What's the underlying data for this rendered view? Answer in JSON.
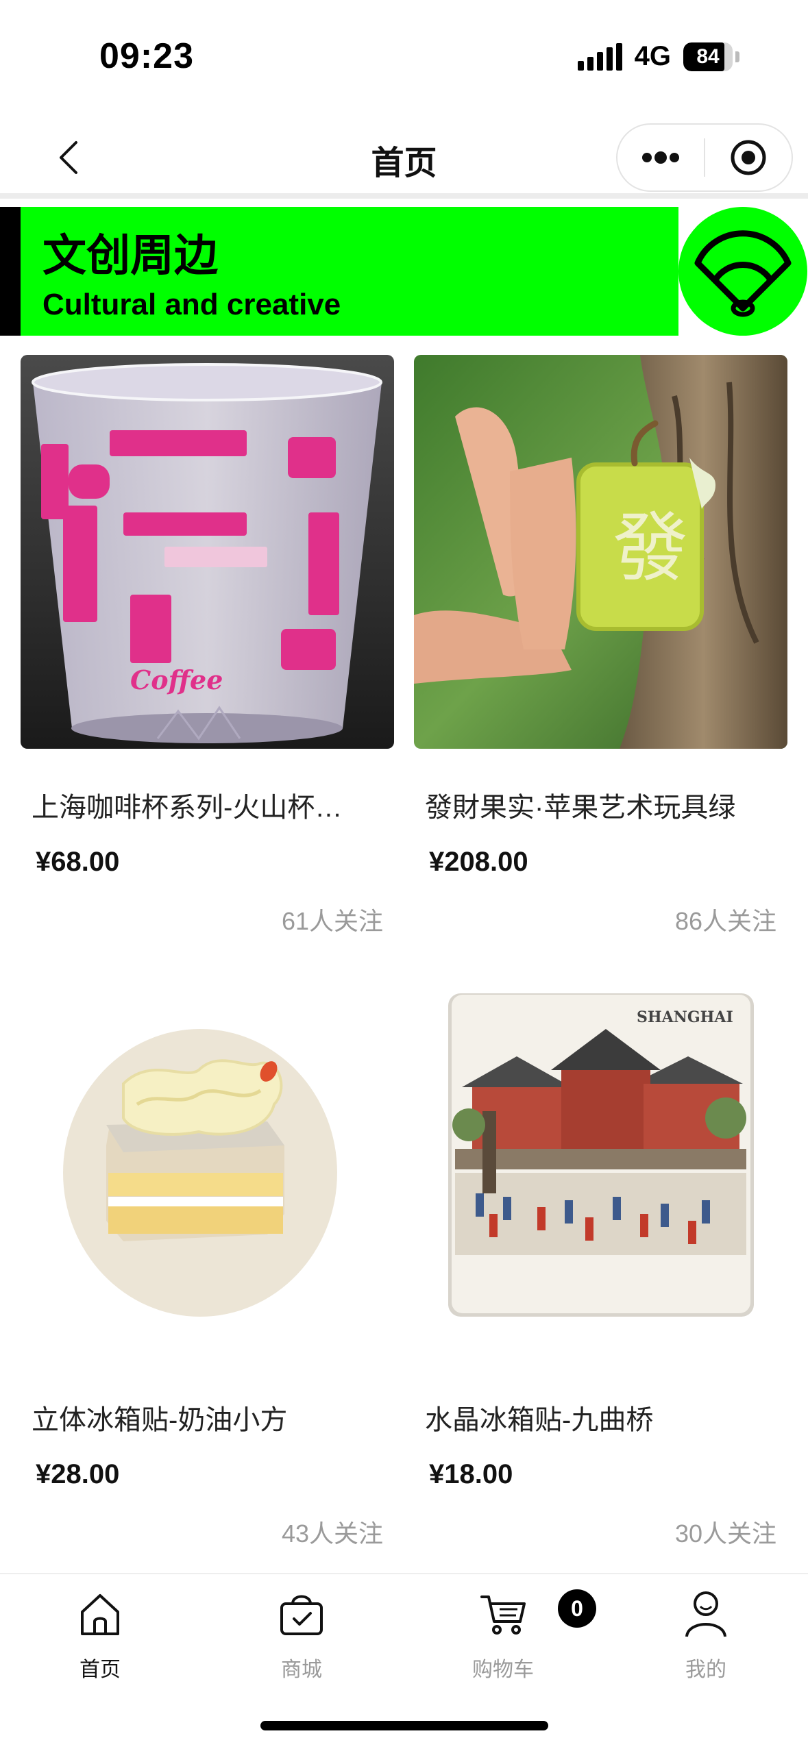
{
  "status": {
    "time": "09:23",
    "network": "4G",
    "battery": "84",
    "battery_fraction": 0.84
  },
  "nav": {
    "title": "首页"
  },
  "banner": {
    "title_cn": "文创周边",
    "title_en": "Cultural and creative"
  },
  "products": [
    {
      "name": "上海咖啡杯系列-火山杯…",
      "price": "¥68.00",
      "followers": "61人关注",
      "image_icon": "coffee-glass-photo"
    },
    {
      "name": "發財果实·苹果艺术玩具绿",
      "price": "¥208.00",
      "followers": "86人关注",
      "image_icon": "mahjong-apple-photo"
    },
    {
      "name": "立体冰箱贴-奶油小方",
      "price": "¥28.00",
      "followers": "43人关注",
      "image_icon": "cake-magnet-photo"
    },
    {
      "name": "水晶冰箱贴-九曲桥",
      "price": "¥18.00",
      "followers": "30人关注",
      "image_icon": "shanghai-magnet-photo"
    }
  ],
  "product_image_text": {
    "glass_brand": "Coffee",
    "mahjong_char": "發",
    "magnet_caption": "SHANGHAI"
  },
  "tabs": [
    {
      "label": "首页",
      "icon": "home-icon",
      "active": true
    },
    {
      "label": "商城",
      "icon": "bag-icon",
      "active": false
    },
    {
      "label": "购物车",
      "icon": "cart-icon",
      "active": false
    },
    {
      "label": "我的",
      "icon": "user-icon",
      "active": false
    }
  ],
  "cart_badge": "0",
  "colors": {
    "accent": "#00ff00",
    "text": "#111111",
    "muted": "#9a9a9a"
  }
}
